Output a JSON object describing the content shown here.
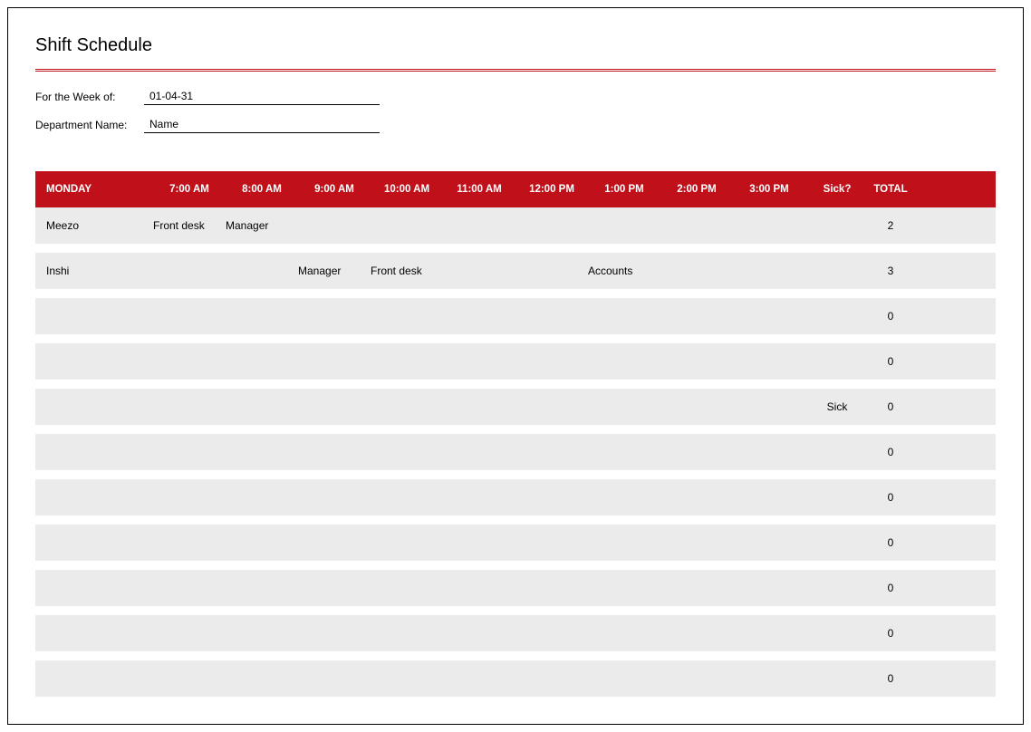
{
  "title": "Shift Schedule",
  "meta": {
    "week_label": "For the Week of:",
    "week_value": "01-04-31",
    "dept_label": "Department Name:",
    "dept_value": "Name"
  },
  "headers": {
    "day": "MONDAY",
    "t7": "7:00 AM",
    "t8": "8:00 AM",
    "t9": "9:00 AM",
    "t10": "10:00 AM",
    "t11": "11:00 AM",
    "t12": "12:00 PM",
    "t13": "1:00 PM",
    "t14": "2:00 PM",
    "t15": "3:00 PM",
    "sick": "Sick?",
    "total": "TOTAL"
  },
  "rows": [
    {
      "name": "Meezo",
      "t7": "Front desk",
      "t8": "Manager",
      "t9": "",
      "t10": "",
      "t11": "",
      "t12": "",
      "t13": "",
      "t14": "",
      "t15": "",
      "sick": "",
      "total": "2"
    },
    {
      "name": "Inshi",
      "t7": "",
      "t8": "",
      "t9": "Manager",
      "t10": "Front desk",
      "t11": "",
      "t12": "",
      "t13": "Accounts",
      "t14": "",
      "t15": "",
      "sick": "",
      "total": "3"
    },
    {
      "name": "",
      "t7": "",
      "t8": "",
      "t9": "",
      "t10": "",
      "t11": "",
      "t12": "",
      "t13": "",
      "t14": "",
      "t15": "",
      "sick": "",
      "total": "0"
    },
    {
      "name": "",
      "t7": "",
      "t8": "",
      "t9": "",
      "t10": "",
      "t11": "",
      "t12": "",
      "t13": "",
      "t14": "",
      "t15": "",
      "sick": "",
      "total": "0"
    },
    {
      "name": "",
      "t7": "",
      "t8": "",
      "t9": "",
      "t10": "",
      "t11": "",
      "t12": "",
      "t13": "",
      "t14": "",
      "t15": "",
      "sick": "Sick",
      "total": "0"
    },
    {
      "name": "",
      "t7": "",
      "t8": "",
      "t9": "",
      "t10": "",
      "t11": "",
      "t12": "",
      "t13": "",
      "t14": "",
      "t15": "",
      "sick": "",
      "total": "0"
    },
    {
      "name": "",
      "t7": "",
      "t8": "",
      "t9": "",
      "t10": "",
      "t11": "",
      "t12": "",
      "t13": "",
      "t14": "",
      "t15": "",
      "sick": "",
      "total": "0"
    },
    {
      "name": "",
      "t7": "",
      "t8": "",
      "t9": "",
      "t10": "",
      "t11": "",
      "t12": "",
      "t13": "",
      "t14": "",
      "t15": "",
      "sick": "",
      "total": "0"
    },
    {
      "name": "",
      "t7": "",
      "t8": "",
      "t9": "",
      "t10": "",
      "t11": "",
      "t12": "",
      "t13": "",
      "t14": "",
      "t15": "",
      "sick": "",
      "total": "0"
    },
    {
      "name": "",
      "t7": "",
      "t8": "",
      "t9": "",
      "t10": "",
      "t11": "",
      "t12": "",
      "t13": "",
      "t14": "",
      "t15": "",
      "sick": "",
      "total": "0"
    },
    {
      "name": "",
      "t7": "",
      "t8": "",
      "t9": "",
      "t10": "",
      "t11": "",
      "t12": "",
      "t13": "",
      "t14": "",
      "t15": "",
      "sick": "",
      "total": "0"
    }
  ]
}
